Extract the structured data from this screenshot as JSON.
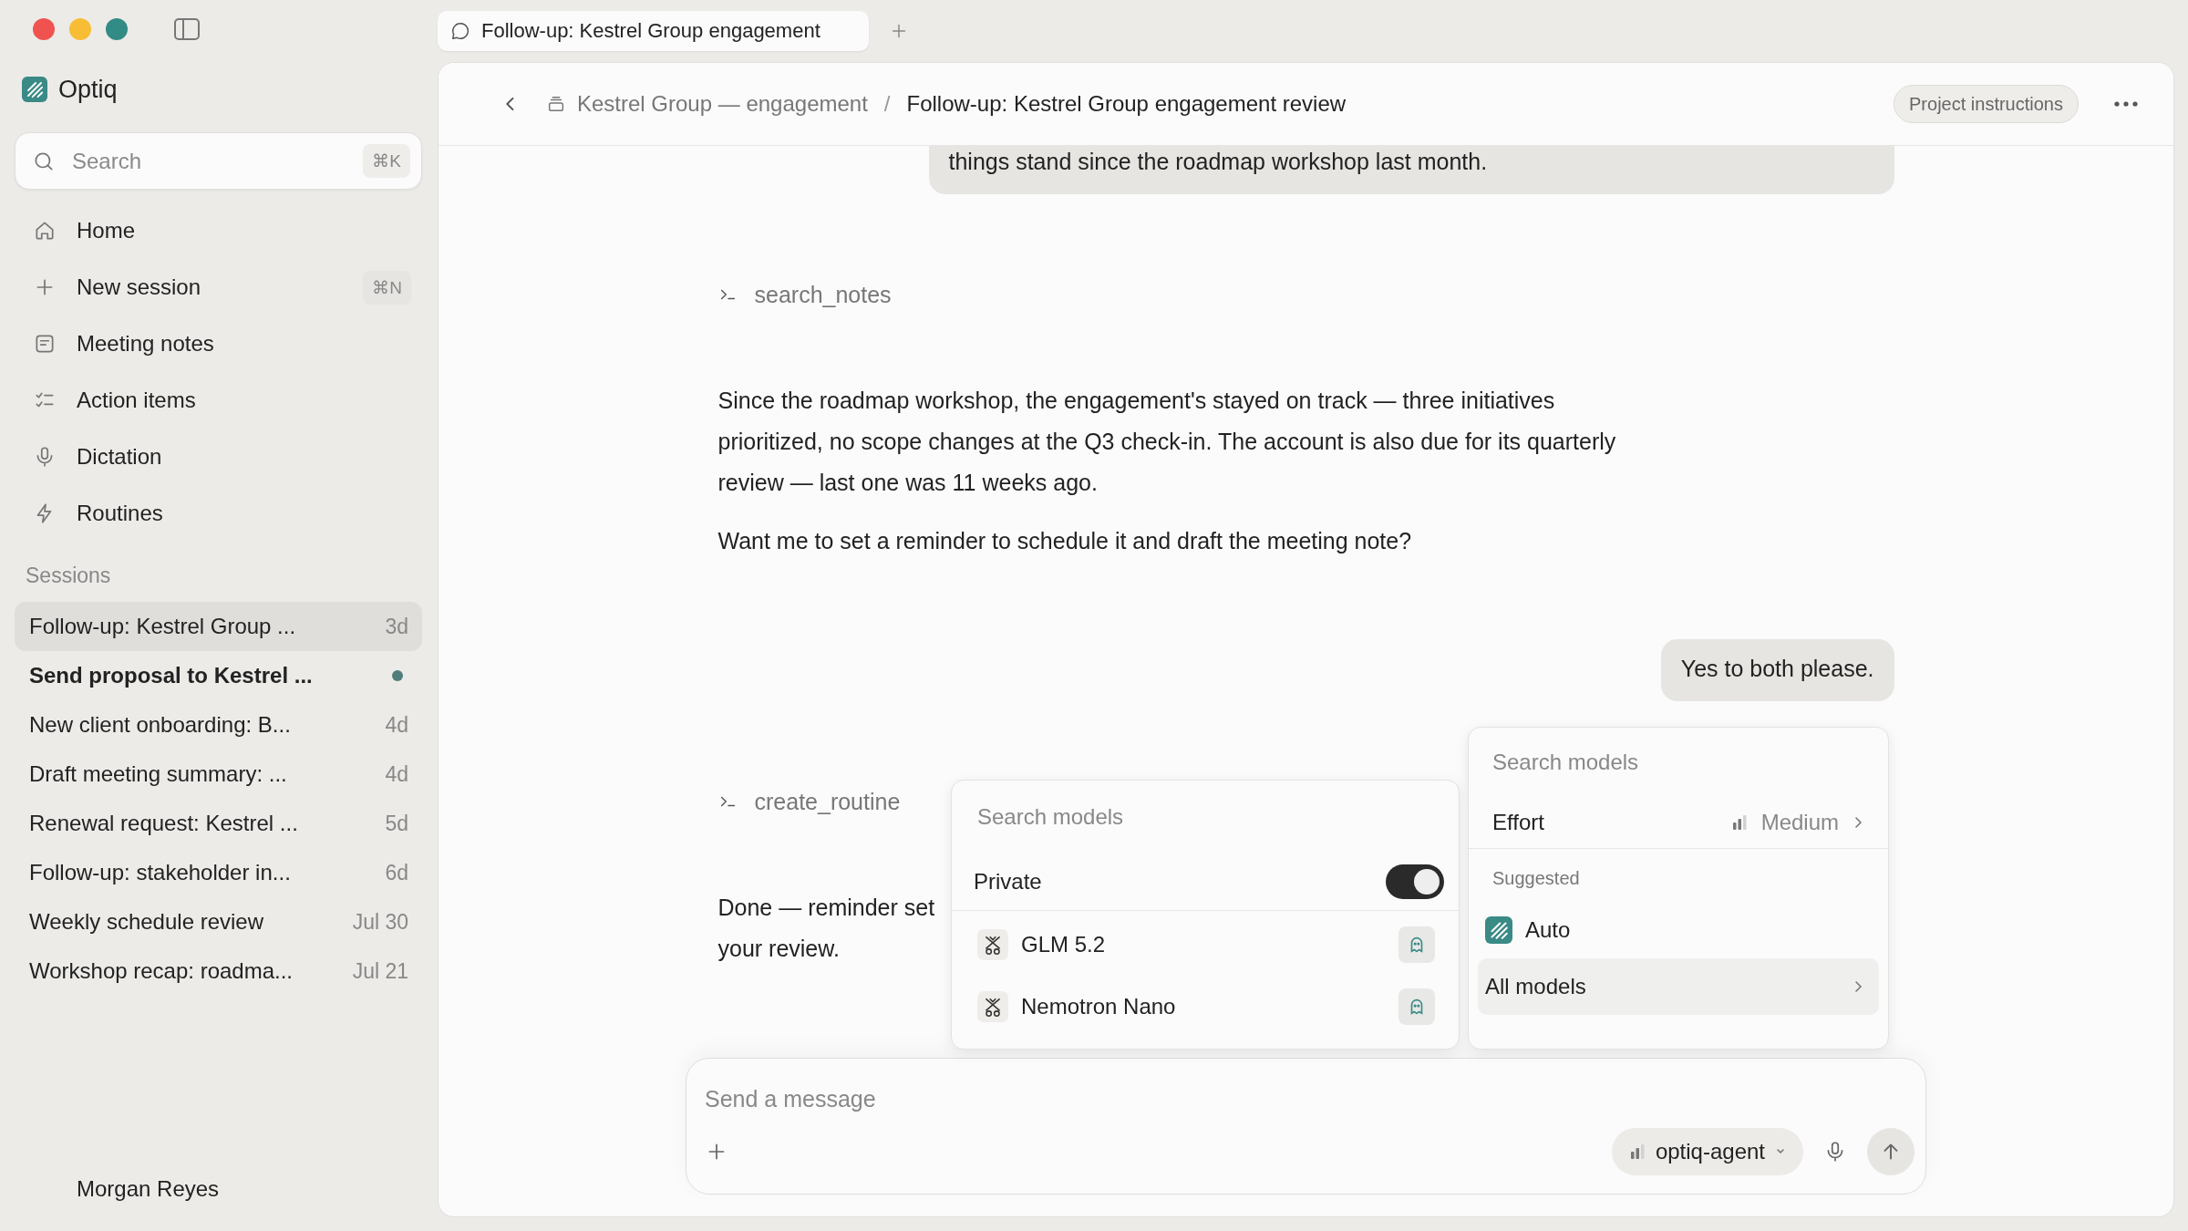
{
  "tabs": [
    {
      "label": "Follow-up: Kestrel Group engagement",
      "selected": true
    }
  ],
  "sidebar": {
    "app_name": "Optiq",
    "search": {
      "placeholder": "Search",
      "shortcut": "⌘K"
    },
    "nav": [
      {
        "kind": "home",
        "label": "Home"
      },
      {
        "kind": "new",
        "label": "New session",
        "shortcut": "⌘N"
      },
      {
        "kind": "notes",
        "label": "Meeting notes"
      },
      {
        "kind": "actions",
        "label": "Action items"
      },
      {
        "kind": "dictation",
        "label": "Dictation"
      },
      {
        "kind": "routines",
        "label": "Routines"
      }
    ],
    "sessions_heading": "Sessions",
    "sessions": [
      {
        "title": "Follow-up: Kestrel Group ...",
        "time": "3d",
        "selected": true,
        "unread": false
      },
      {
        "title": "Send proposal to Kestrel ...",
        "selected": false,
        "unread": true
      },
      {
        "title": "New client onboarding: B...",
        "time": "4d",
        "selected": false,
        "unread": false
      },
      {
        "title": "Draft meeting summary: ...",
        "time": "4d",
        "selected": false,
        "unread": false
      },
      {
        "title": "Renewal request: Kestrel ...",
        "time": "5d",
        "selected": false,
        "unread": false
      },
      {
        "title": "Follow-up: stakeholder in...",
        "time": "6d",
        "selected": false,
        "unread": false
      },
      {
        "title": "Weekly schedule review",
        "time": "Jul 30",
        "selected": false,
        "unread": false
      },
      {
        "title": "Workshop recap: roadma...",
        "time": "Jul 21",
        "selected": false,
        "unread": false
      }
    ],
    "user": {
      "name": "Morgan Reyes"
    }
  },
  "header": {
    "project": "Kestrel Group — engagement",
    "separator": "/",
    "current": "Follow-up: Kestrel Group engagement review",
    "button": "Project instructions"
  },
  "messages": [
    {
      "kind": "user",
      "lines": [
        "things stand since the roadmap workshop last month."
      ]
    },
    {
      "kind": "tool",
      "name": "search_notes"
    },
    {
      "kind": "assistant",
      "paragraphs": [
        "Since the roadmap workshop, the engagement's stayed on track — three initiatives prioritized, no scope changes at the Q3 check-in. The account is also due for its quarterly review — last one was 11 weeks ago.",
        "Want me to set a reminder to schedule it and draft the meeting note?"
      ]
    },
    {
      "kind": "user",
      "lines": [
        "Yes to both please."
      ]
    },
    {
      "kind": "tool",
      "name": "create_routine"
    },
    {
      "kind": "assistant",
      "lines": [
        "Done — reminder set",
        "your review."
      ]
    }
  ],
  "private_menu": {
    "search_placeholder": "Search models",
    "private": {
      "label": "Private",
      "on": true
    },
    "models": [
      {
        "label": "GLM 5.2"
      },
      {
        "label": "Nemotron Nano"
      }
    ]
  },
  "model_menu": {
    "search_placeholder": "Search models",
    "effort": {
      "label": "Effort",
      "value": "Medium"
    },
    "suggested_heading": "Suggested",
    "items": [
      {
        "kind": "model",
        "label": "Auto",
        "selected": false
      },
      {
        "kind": "submenu",
        "label": "All models",
        "selected": true
      }
    ]
  },
  "composer": {
    "placeholder": "Send a message",
    "model": "optiq-agent"
  }
}
